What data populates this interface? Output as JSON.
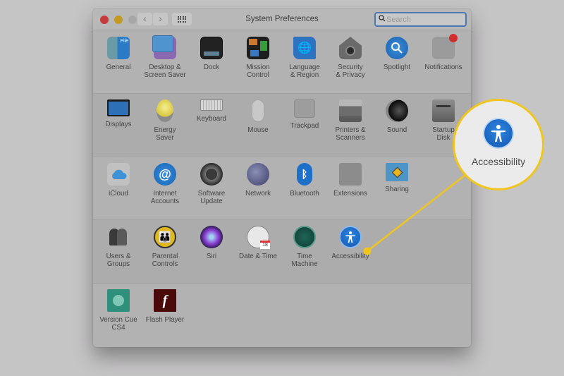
{
  "window": {
    "title": "System Preferences",
    "search_placeholder": "Search",
    "search_value": "",
    "nav": {
      "back": "‹",
      "forward": "›"
    }
  },
  "colors": {
    "callout_accent": "#f0c51e",
    "search_focus": "#4d77b0",
    "close": "#c6393c",
    "minimize": "#c49a22"
  },
  "sections": [
    {
      "items": [
        {
          "label": "General",
          "icon": "general-icon"
        },
        {
          "label": "Desktop &\nScreen Saver",
          "icon": "desktop-screen-saver-icon"
        },
        {
          "label": "Dock",
          "icon": "dock-icon"
        },
        {
          "label": "Mission\nControl",
          "icon": "mission-control-icon"
        },
        {
          "label": "Language\n& Region",
          "icon": "language-region-icon"
        },
        {
          "label": "Security\n& Privacy",
          "icon": "security-privacy-icon"
        },
        {
          "label": "Spotlight",
          "icon": "spotlight-icon"
        },
        {
          "label": "Notifications",
          "icon": "notifications-icon"
        }
      ]
    },
    {
      "items": [
        {
          "label": "Displays",
          "icon": "displays-icon"
        },
        {
          "label": "Energy\nSaver",
          "icon": "energy-saver-icon"
        },
        {
          "label": "Keyboard",
          "icon": "keyboard-icon"
        },
        {
          "label": "Mouse",
          "icon": "mouse-icon"
        },
        {
          "label": "Trackpad",
          "icon": "trackpad-icon"
        },
        {
          "label": "Printers &\nScanners",
          "icon": "printers-scanners-icon"
        },
        {
          "label": "Sound",
          "icon": "sound-icon"
        },
        {
          "label": "Startup\nDisk",
          "icon": "startup-disk-icon"
        }
      ]
    },
    {
      "items": [
        {
          "label": "iCloud",
          "icon": "icloud-icon"
        },
        {
          "label": "Internet\nAccounts",
          "icon": "internet-accounts-icon"
        },
        {
          "label": "Software\nUpdate",
          "icon": "software-update-icon"
        },
        {
          "label": "Network",
          "icon": "network-icon"
        },
        {
          "label": "Bluetooth",
          "icon": "bluetooth-icon"
        },
        {
          "label": "Extensions",
          "icon": "extensions-icon"
        },
        {
          "label": "Sharing",
          "icon": "sharing-icon"
        }
      ]
    },
    {
      "items": [
        {
          "label": "Users &\nGroups",
          "icon": "users-groups-icon"
        },
        {
          "label": "Parental\nControls",
          "icon": "parental-controls-icon"
        },
        {
          "label": "Siri",
          "icon": "siri-icon"
        },
        {
          "label": "Date & Time",
          "icon": "date-time-icon"
        },
        {
          "label": "Time\nMachine",
          "icon": "time-machine-icon"
        },
        {
          "label": "Accessibility",
          "icon": "accessibility-icon"
        }
      ]
    },
    {
      "items": [
        {
          "label": "Version Cue\nCS4",
          "icon": "version-cue-icon"
        },
        {
          "label": "Flash Player",
          "icon": "flash-player-icon"
        }
      ]
    }
  ],
  "callout": {
    "label": "Accessibility",
    "icon": "accessibility-icon"
  }
}
